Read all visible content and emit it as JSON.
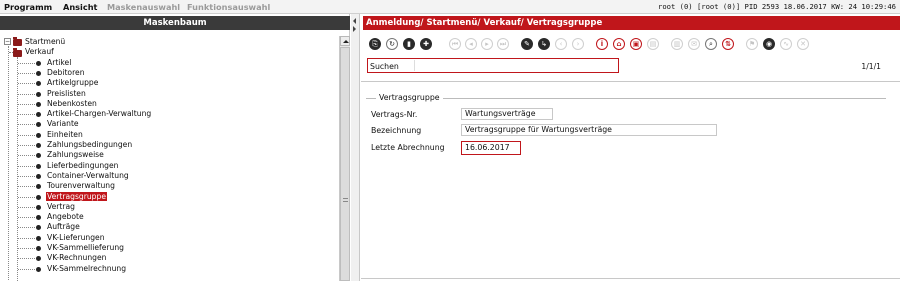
{
  "menubar": {
    "items": [
      "Programm",
      "Ansicht",
      "Maskenauswahl",
      "Funktionsauswahl"
    ],
    "status": "root (0) [root (0)] PID 2593  18.06.2017 KW: 24  10:29:46"
  },
  "left_panel": {
    "title": "Maskenbaum",
    "tree": {
      "root": "Startmenü",
      "folder": "Verkauf",
      "items": [
        "Artikel",
        "Debitoren",
        "Artikelgruppe",
        "Preislisten",
        "Nebenkosten",
        "Artikel-Chargen-Verwaltung",
        "Variante",
        "Einheiten",
        "Zahlungsbedingungen",
        "Zahlungsweise",
        "Lieferbedingungen",
        "Container-Verwaltung",
        "Tourenverwaltung",
        "Vertragsgruppe",
        "Vertrag",
        "Angebote",
        "Aufträge",
        "VK-Lieferungen",
        "VK-Sammellieferung",
        "VK-Rechnungen",
        "VK-Sammelrechnung"
      ],
      "selected": "Vertragsgruppe"
    }
  },
  "right_panel": {
    "title": "Anmeldung/ Startmenü/ Verkauf/ Vertragsgruppe",
    "search": {
      "label": "Suchen",
      "value": ""
    },
    "pager": "1/1/1",
    "group_title": "Vertragsgruppe",
    "fields": {
      "nr_label": "Vertrags-Nr.",
      "nr_value": "Wartungsverträge",
      "bez_label": "Bezeichnung",
      "bez_value": "Vertragsgruppe für Wartungsverträge",
      "date_label": "Letzte Abrechnung",
      "date_value": "16.06.2017"
    }
  },
  "toolbar_icons": [
    "copy-icon",
    "refresh-icon",
    "delete-icon",
    "add-icon",
    "first-icon",
    "prev-icon",
    "next-icon",
    "last-icon",
    "edit-icon",
    "goto-icon",
    "search-prev-icon",
    "search-next-icon",
    "info-icon",
    "home-icon",
    "save-icon",
    "save-as-icon",
    "print-icon",
    "mail-icon",
    "find-icon",
    "sort-icon",
    "flag-icon",
    "settings-icon",
    "link-icon",
    "tools-icon"
  ],
  "colors": {
    "accent": "#c0161b",
    "title_bar": "#3a3a3a"
  }
}
